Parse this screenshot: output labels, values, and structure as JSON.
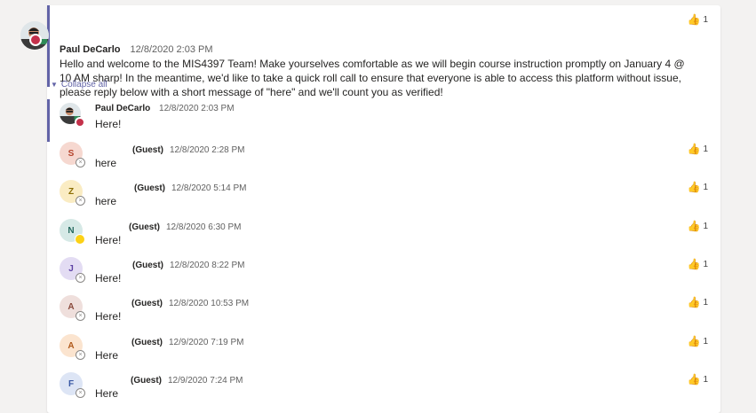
{
  "main_post": {
    "author": "Paul DeCarlo",
    "timestamp": "12/8/2020 2:03 PM",
    "body": "Hello and welcome to the MIS4397 Team!  Make yourselves comfortable as we will begin course instruction promptly on January 4 @ 10 AM sharp!  In the meantime, we'd like to take a quick roll call to ensure that everyone is able to access this platform without issue, please reply below with a short message of \"here\" and we'll count you as verified!",
    "reaction_count": "1",
    "reaction_icon": "thumbs-up-icon"
  },
  "collapse_label": "Collapse all",
  "first_reply": {
    "author": "Paul DeCarlo",
    "timestamp": "12/8/2020 2:03 PM",
    "body": "Here!"
  },
  "replies": [
    {
      "initial": "S",
      "guest_label": "(Guest)",
      "timestamp": "12/8/2020 2:28 PM",
      "body": "here",
      "reaction_count": "1",
      "avatar_bg": "#f6d8d0",
      "avatar_fg": "#b5442d",
      "status": "guest"
    },
    {
      "initial": "Z",
      "guest_label": "(Guest)",
      "timestamp": "12/8/2020 5:14 PM",
      "body": "here",
      "reaction_count": "1",
      "avatar_bg": "#faecc3",
      "avatar_fg": "#8a6d00",
      "status": "guest"
    },
    {
      "initial": "N",
      "guest_label": "(Guest)",
      "timestamp": "12/8/2020 6:30 PM",
      "body": "Here!",
      "reaction_count": "1",
      "avatar_bg": "#d6e9e6",
      "avatar_fg": "#256a5f",
      "status": "away"
    },
    {
      "initial": "J",
      "guest_label": "(Guest)",
      "timestamp": "12/8/2020 8:22 PM",
      "body": "Here!",
      "reaction_count": "1",
      "avatar_bg": "#e3dcf3",
      "avatar_fg": "#5b3fa3",
      "status": "guest"
    },
    {
      "initial": "A",
      "guest_label": "(Guest)",
      "timestamp": "12/8/2020 10:53 PM",
      "body": "Here!",
      "reaction_count": "1",
      "avatar_bg": "#efdfdc",
      "avatar_fg": "#8a4a3c",
      "status": "guest"
    },
    {
      "initial": "A",
      "guest_label": "(Guest)",
      "timestamp": "12/9/2020 7:19 PM",
      "body": "Here",
      "reaction_count": "1",
      "avatar_bg": "#fbe4cf",
      "avatar_fg": "#b0591a",
      "status": "guest"
    },
    {
      "initial": "F",
      "guest_label": "(Guest)",
      "timestamp": "12/9/2020 7:24 PM",
      "body": "Here",
      "reaction_count": "1",
      "avatar_bg": "#dde5f5",
      "avatar_fg": "#3857a3",
      "status": "guest"
    }
  ],
  "colors": {
    "accent": "#6264a7",
    "dnd": "#c4314b",
    "away": "#fcd116"
  }
}
